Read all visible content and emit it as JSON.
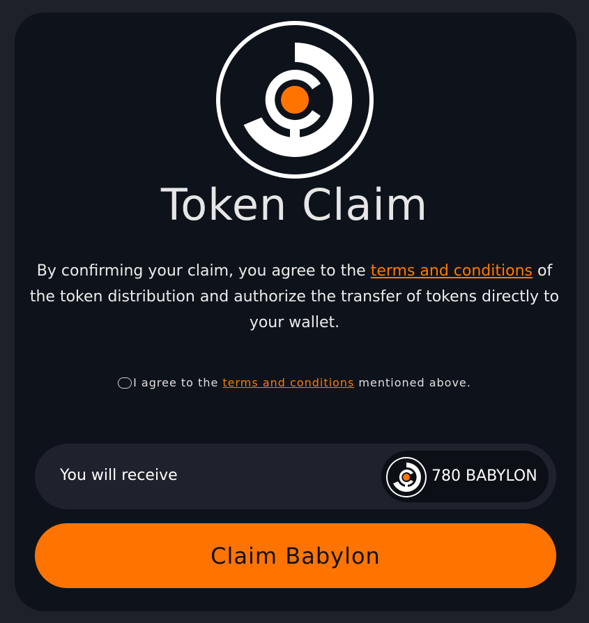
{
  "colors": {
    "accent": "#ff7400",
    "card_background": "#0e121a",
    "page_background": "#1e212a"
  },
  "logo": {
    "icon": "babylon-logo-icon"
  },
  "title": "Token Claim",
  "description": {
    "before_link": "By confirming your claim, you agree to the ",
    "link_text": "terms and conditions",
    "after_link": " of the token distribution and authorize the transfer of tokens directly to your wallet."
  },
  "agreement": {
    "checked": false,
    "before_link": "I agree to the ",
    "link_text": "terms and conditions",
    "after_link": " mentioned above."
  },
  "receive": {
    "label": "You will receive",
    "amount": "780 BABYLON",
    "token_icon": "babylon-token-icon"
  },
  "claim_button": {
    "label": "Claim Babylon"
  }
}
